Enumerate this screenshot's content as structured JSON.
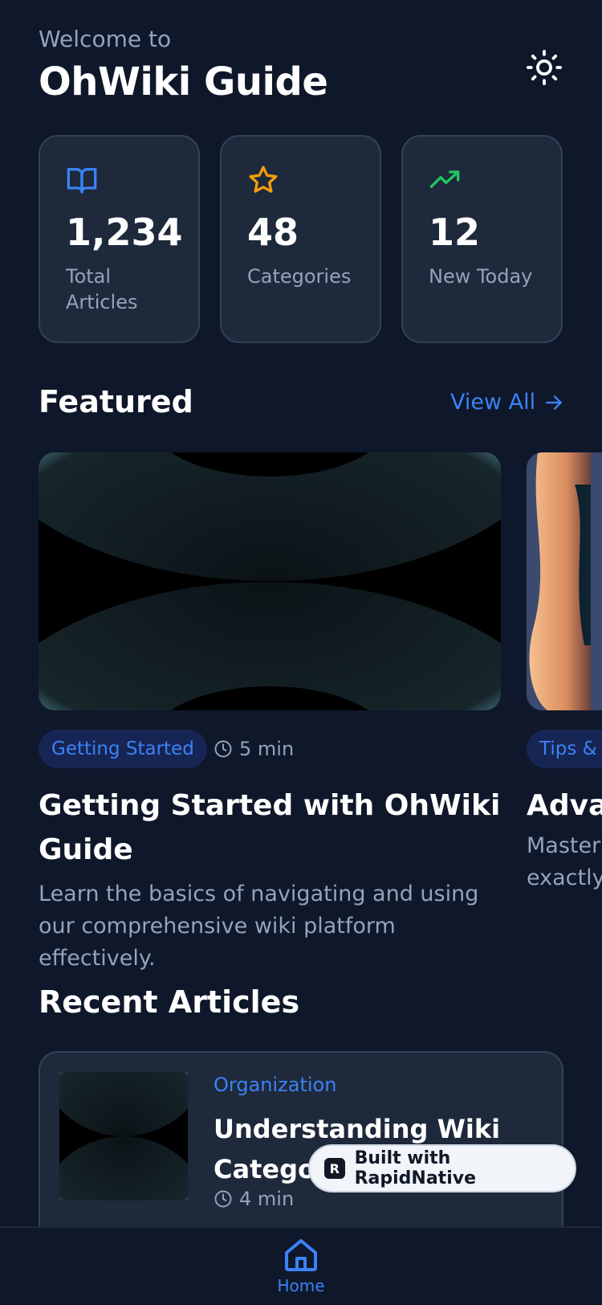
{
  "header": {
    "welcome": "Welcome to",
    "title": "OhWiki Guide",
    "theme_icon": "sun-icon"
  },
  "stats": [
    {
      "icon": "book-open-icon",
      "value": "1,234",
      "label": "Total Articles",
      "color": "#3b82f6"
    },
    {
      "icon": "star-icon",
      "value": "48",
      "label": "Categories",
      "color": "#f59e0b"
    },
    {
      "icon": "trending-up-icon",
      "value": "12",
      "label": "New Today",
      "color": "#22c55e"
    }
  ],
  "featured": {
    "title": "Featured",
    "view_all": "View All",
    "items": [
      {
        "category": "Getting Started",
        "read_time": "5 min",
        "title": "Getting Started with OhWiki Guide",
        "description": "Learn the basics of navigating and using our comprehensive wiki platform effectively."
      },
      {
        "category": "Tips & T",
        "title": "Advan",
        "description": "Master exactly"
      }
    ]
  },
  "recent": {
    "title": "Recent Articles",
    "items": [
      {
        "category": "Organization",
        "title": "Understanding Wiki Categories",
        "read_time": "4 min"
      }
    ]
  },
  "built_with": "Built with RapidNative",
  "nav": {
    "home_label": "Home"
  },
  "colors": {
    "background": "#0f172a",
    "card": "#1e293b",
    "accent": "#3b82f6",
    "muted": "#94a3b8"
  }
}
